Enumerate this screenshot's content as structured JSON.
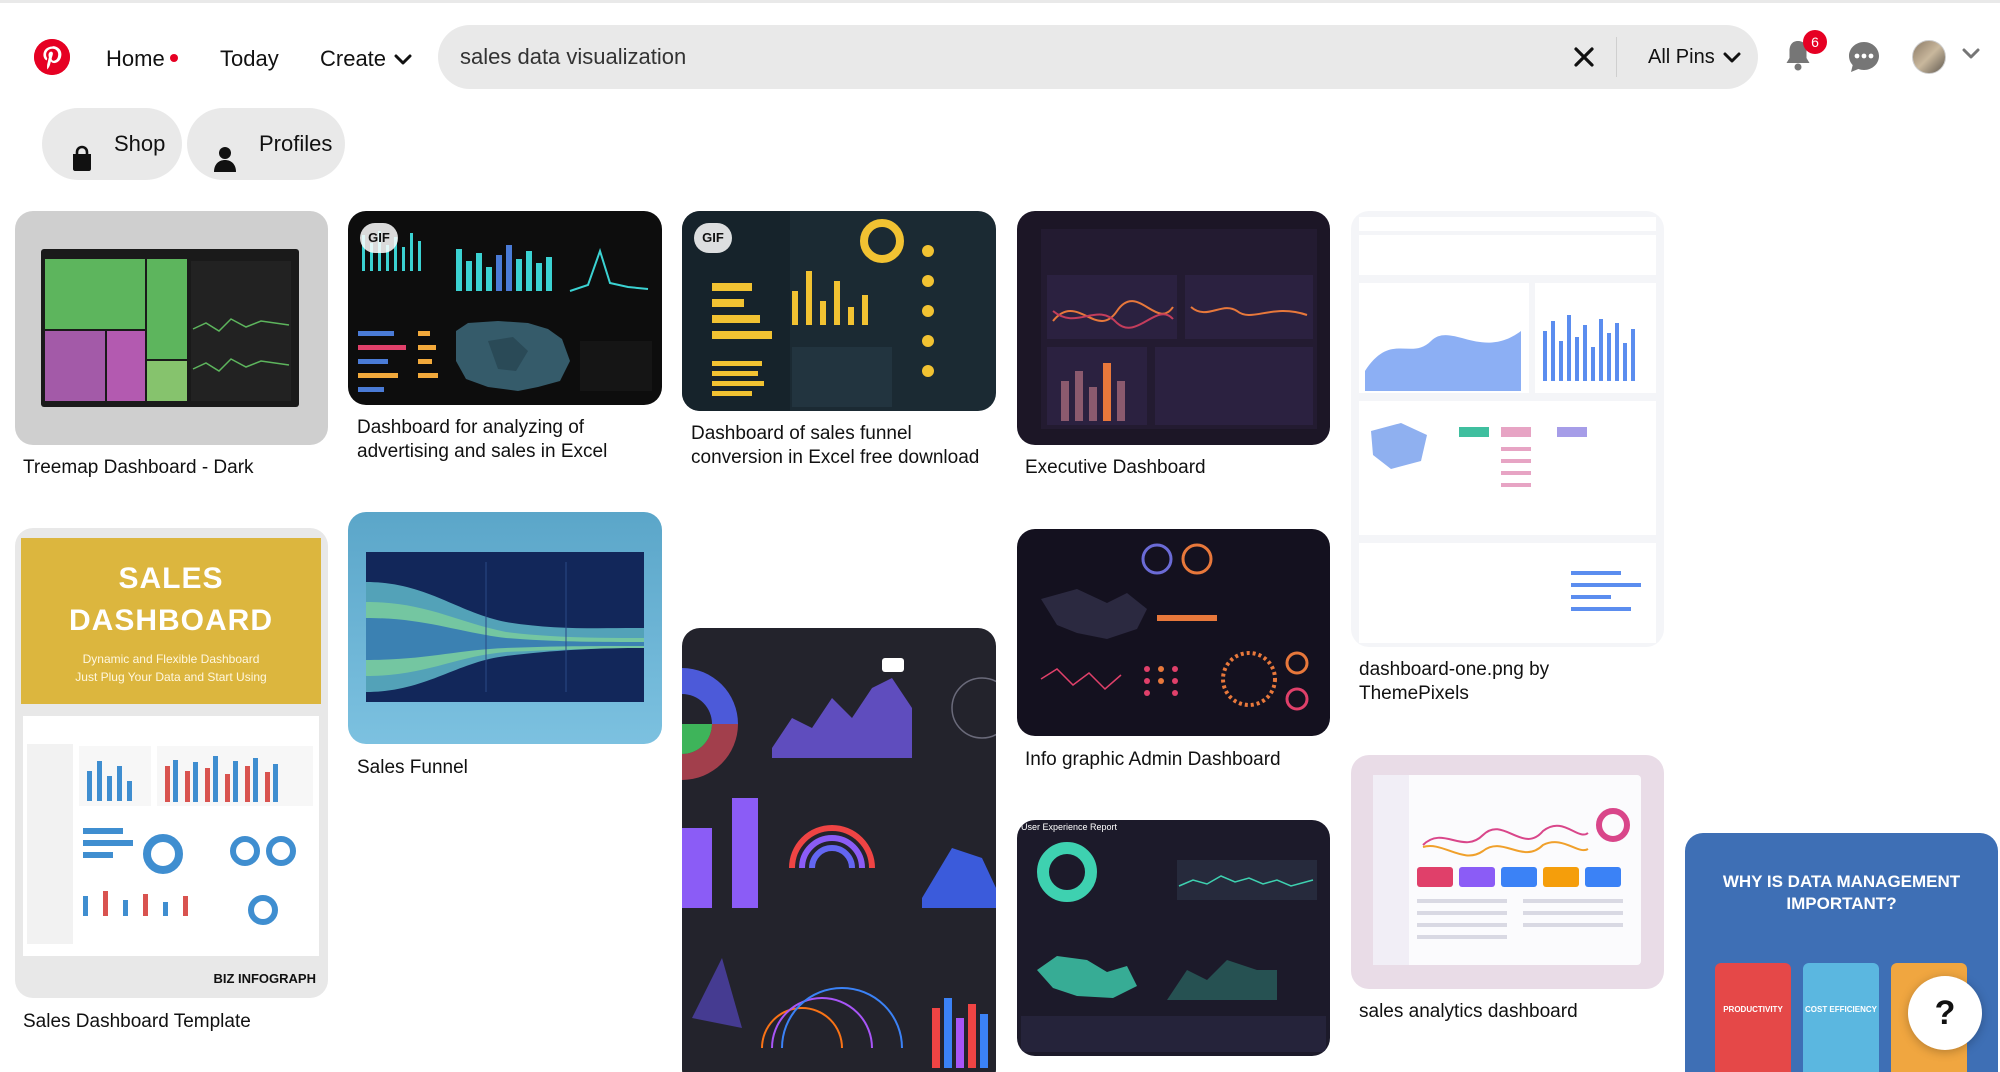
{
  "header": {
    "nav": {
      "home": "Home",
      "today": "Today",
      "create": "Create"
    },
    "search": {
      "query": "sales data visualization",
      "scope": "All Pins"
    },
    "notifications_count": "6"
  },
  "filters": [
    {
      "label": "Shop",
      "icon": "shopping-bag-icon"
    },
    {
      "label": "Profiles",
      "icon": "person-icon"
    }
  ],
  "pins": {
    "p1": {
      "title": "Treemap Dashboard - Dark"
    },
    "p2": {
      "title": "Sales Dashboard Template",
      "image_heading": "SALES DASHBOARD",
      "image_sub1": "Dynamic and Flexible Dashboard",
      "image_sub2": "Just Plug Your Data and Start Using",
      "image_brand": "BIZ INFOGRAPH"
    },
    "p3": {
      "title": "Dashboard for analyzing of advertising and sales in Excel",
      "badge": "GIF"
    },
    "p4": {
      "title": "Sales Funnel"
    },
    "p5": {
      "title": "Dashboard of sales funnel conversion in Excel free download",
      "badge": "GIF"
    },
    "p7": {
      "title": "Executive Dashboard"
    },
    "p8": {
      "title": "Info graphic Admin Dashboard"
    },
    "p9": {
      "image_heading": "User Experience Report"
    },
    "p10": {
      "title": "dashboard-one.png by ThemePixels"
    },
    "p11": {
      "title": "sales analytics dashboard"
    },
    "p12": {
      "image_heading": "WHY IS DATA MANAGEMENT IMPORTANT?",
      "cards": [
        "PRODUCTIVITY",
        "COST EFFICIENCY",
        ""
      ]
    }
  },
  "help_label": "?",
  "colors": {
    "brand": "#e60023",
    "pill_bg": "#e9e9e9"
  }
}
